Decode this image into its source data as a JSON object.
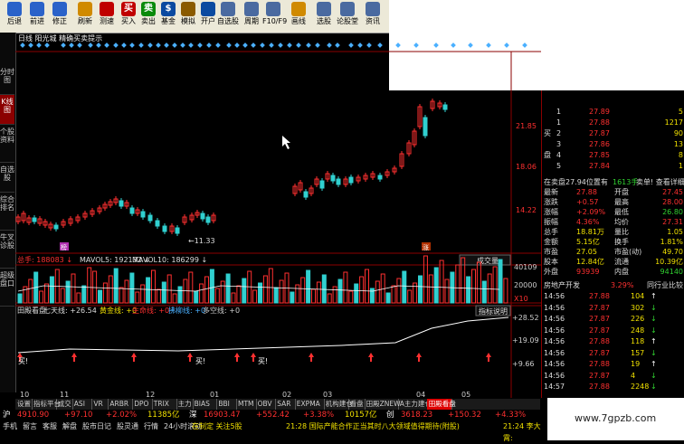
{
  "toolbar": {
    "buttons": [
      {
        "label": "后退",
        "icon": "back-arrow-icon",
        "color": "#2a62c9"
      },
      {
        "label": "前进",
        "icon": "forward-arrow-icon",
        "color": "#2a62c9"
      },
      {
        "label": "修正",
        "icon": "up-arrow-icon",
        "color": "#2a62c9"
      },
      {
        "label": "刷新",
        "icon": "refresh-icon",
        "color": "#d08a00"
      },
      {
        "label": "测速",
        "icon": "no-entry-icon",
        "color": "#c00000"
      },
      {
        "label": "买入",
        "icon": "buy-icon",
        "color": "#c00000",
        "glyph": "买"
      },
      {
        "label": "卖出",
        "icon": "sell-icon",
        "color": "#0a8a0a",
        "glyph": "卖"
      },
      {
        "label": "基金",
        "icon": "fund-icon",
        "color": "#0a4aa0",
        "glyph": "$"
      },
      {
        "label": "模拟",
        "icon": "hammer-icon",
        "color": "#8a5a00"
      },
      {
        "label": "开户",
        "icon": "open-account-icon",
        "color": "#0a4aa0"
      },
      {
        "label": "自选股",
        "icon": "watchlist-icon",
        "color": "#4a6aa0"
      },
      {
        "label": "周期",
        "icon": "period-icon",
        "color": "#4a6aa0"
      },
      {
        "label": "F10/F9",
        "icon": "f10-icon",
        "color": "#4a6aa0"
      },
      {
        "label": "画线",
        "icon": "pencil-icon",
        "color": "#d08a00"
      },
      {
        "label": "选股",
        "icon": "stock-picker-icon",
        "color": "#4a6aa0"
      },
      {
        "label": "论股堂",
        "icon": "forum-icon",
        "color": "#4a6aa0"
      },
      {
        "label": "资讯",
        "icon": "news-icon",
        "color": "#4a6aa0"
      }
    ]
  },
  "sidebar": {
    "tabs": [
      "分时图",
      "K线图",
      "个股资料",
      "自选股",
      "综合排名",
      "牛叉诊股",
      "超级盘口"
    ],
    "active": "K线图"
  },
  "main": {
    "chart_title": "日线 阳光城 精确买卖提示",
    "badge_left": "榜",
    "badge_right": "涨",
    "low_label": "11.33",
    "price_axis": [
      "21.85",
      "18.06",
      "14.22"
    ],
    "volume_header": {
      "total": "总手: 188083",
      "mavol5": "MAVOL5: 192132",
      "mavol10": "MAVOL10: 186299",
      "button": "成交量"
    },
    "volume_axis": [
      "40109",
      "20000",
      "X10"
    ],
    "indicator_header": {
      "name": "田殿看盘",
      "qitian": "七天线: +26.54",
      "huangjin": "黄金线: +0",
      "shengming": "生命线: +0",
      "zhenfu": "拂柳线: +0",
      "duokong": "多空线: +0",
      "button": "指标说明"
    },
    "indicator_axis": [
      "+28.52",
      "+19.09",
      "+9.66"
    ],
    "buy_labels": [
      "买!",
      "买!",
      "买!"
    ],
    "date_ticks": [
      "10",
      "11",
      "12",
      "01",
      "02",
      "03",
      "04",
      "05"
    ]
  },
  "bottom_tabs": [
    "设置",
    "指标平台",
    "成交",
    "ASI",
    "VR",
    "ARBR",
    "DPO",
    "TRIX",
    "主力",
    "BIAS",
    "BBI",
    "MTM",
    "OBV",
    "SAR",
    "EXPMA",
    "机构建仓",
    "看盘",
    "田殿ZNEW",
    "A主力建仓",
    "田殿看盘"
  ],
  "active_bottom_tab": "田殿看盘",
  "quote": {
    "order_book": [
      {
        "side": "",
        "level": "1",
        "price": "27.89",
        "vol": "5"
      },
      {
        "side": "",
        "level": "1",
        "price": "27.88",
        "vol": "1217"
      },
      {
        "side": "买",
        "level": "2",
        "price": "27.87",
        "vol": "90"
      },
      {
        "side": "",
        "level": "3",
        "price": "27.86",
        "vol": "13"
      },
      {
        "side": "盘",
        "level": "4",
        "price": "27.85",
        "vol": "8"
      },
      {
        "side": "",
        "level": "5",
        "price": "27.84",
        "vol": "1"
      }
    ],
    "sell_line": "在卖盘27.94位置有",
    "sell_vol": "1613手",
    "sell_hint": "卖单! 查看详细",
    "stats": [
      {
        "l1": "最新",
        "v1": "27.88",
        "l2": "开盘",
        "v2": "27.45",
        "c1": "#ff3030",
        "c2": "#ff3030"
      },
      {
        "l1": "涨跌",
        "v1": "+0.57",
        "l2": "最高",
        "v2": "28.00",
        "c1": "#ff3030",
        "c2": "#ff3030"
      },
      {
        "l1": "涨幅",
        "v1": "+2.09%",
        "l2": "最低",
        "v2": "26.80",
        "c1": "#ff3030",
        "c2": "#30d030"
      },
      {
        "l1": "振幅",
        "v1": "4.36%",
        "l2": "均价",
        "v2": "27.31",
        "c1": "#ff3030",
        "c2": "#ff3030"
      },
      {
        "l1": "总手",
        "v1": "18.81万",
        "l2": "量比",
        "v2": "1.05",
        "c1": "#f0e000",
        "c2": "#f0e000"
      },
      {
        "l1": "金额",
        "v1": "5.15亿",
        "l2": "换手",
        "v2": "1.81%",
        "c1": "#f0e000",
        "c2": "#f0e000"
      },
      {
        "l1": "市盈",
        "v1": "27.05",
        "l2": "市盈(动)",
        "v2": "49.70",
        "c1": "#f0e000",
        "c2": "#f0e000"
      },
      {
        "l1": "股本",
        "v1": "12.84亿",
        "l2": "流通",
        "v2": "10.39亿",
        "c1": "#f0e000",
        "c2": "#f0e000"
      },
      {
        "l1": "外盘",
        "v1": "93939",
        "l2": "内盘",
        "v2": "94140",
        "c1": "#ff3030",
        "c2": "#30d030"
      }
    ],
    "sector": "房地产开发",
    "sector_pct": "3.29%",
    "sector_cmp": "同行业比较",
    "ticks": [
      {
        "time": "14:56",
        "price": "27.88",
        "vol": "104",
        "dir": "up"
      },
      {
        "time": "14:56",
        "price": "27.87",
        "vol": "302",
        "dir": "down"
      },
      {
        "time": "14:56",
        "price": "27.87",
        "vol": "226",
        "dir": "down"
      },
      {
        "time": "14:56",
        "price": "27.87",
        "vol": "248",
        "dir": "down"
      },
      {
        "time": "14:56",
        "price": "27.88",
        "vol": "118",
        "dir": "up"
      },
      {
        "time": "14:56",
        "price": "27.87",
        "vol": "157",
        "dir": "down"
      },
      {
        "time": "14:56",
        "price": "27.88",
        "vol": "19",
        "dir": "up"
      },
      {
        "time": "14:56",
        "price": "27.87",
        "vol": "4",
        "dir": "down"
      },
      {
        "time": "14:57",
        "price": "27.88",
        "vol": "2248",
        "dir": "down"
      }
    ]
  },
  "ticker": {
    "items": [
      {
        "t": "沪",
        "c": "#ffffff"
      },
      {
        "t": "4910.90",
        "c": "#ff3030"
      },
      {
        "t": "+97.10",
        "c": "#ff3030"
      },
      {
        "t": "+2.02%",
        "c": "#ff3030"
      },
      {
        "t": "11385亿",
        "c": "#f0e000"
      },
      {
        "t": "深",
        "c": "#ffffff"
      },
      {
        "t": "16903.47",
        "c": "#ff3030"
      },
      {
        "t": "+552.42",
        "c": "#ff3030"
      },
      {
        "t": "+3.38%",
        "c": "#ff3030"
      },
      {
        "t": "10157亿",
        "c": "#f0e000"
      },
      {
        "t": "创",
        "c": "#ffffff"
      },
      {
        "t": "3618.23",
        "c": "#ff3030"
      },
      {
        "t": "+150.32",
        "c": "#ff3030"
      },
      {
        "t": "+4.33%",
        "c": "#ff3030"
      }
    ]
  },
  "status": {
    "items": [
      "手机",
      "留言",
      "客服",
      "解盘",
      "股市日记",
      "股灵通",
      "行情",
      "24小时滚动"
    ],
    "news1": "在制定 关注5股",
    "news2": "21:28 国际产能合作正当其时八大领域值得期待(附股)",
    "news3": "21:24 李大霄:"
  },
  "watermark": "www.7gpzb.com"
}
